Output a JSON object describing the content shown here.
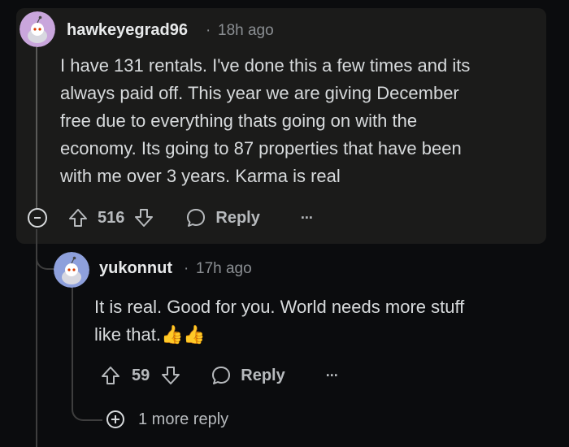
{
  "comment": {
    "username": "hawkeyegrad96",
    "separator": "·",
    "timestamp": "18h ago",
    "body_lines": [
      "I have 131 rentals. I've done this a few times and its",
      "always paid off. This year we are giving December",
      "free due to everything thats going on with the",
      "economy. Its going to 87 properties that have been",
      "with me over 3 years. Karma is real"
    ],
    "score": "516",
    "reply_label": "Reply",
    "more_label": "···"
  },
  "reply": {
    "username": "yukonnut",
    "separator": "·",
    "timestamp": "17h ago",
    "body_lines": [
      "It is real. Good for you. World needs more stuff",
      "like that."
    ],
    "emoji": "👍👍",
    "score": "59",
    "reply_label": "Reply",
    "more_label": "···"
  },
  "more_replies_label": "1 more reply",
  "icons": {
    "upvote": "arrow-up-icon",
    "downvote": "arrow-down-icon",
    "reply": "speech-bubble-icon",
    "collapse": "minus-circle-icon",
    "expand": "plus-circle-icon"
  }
}
